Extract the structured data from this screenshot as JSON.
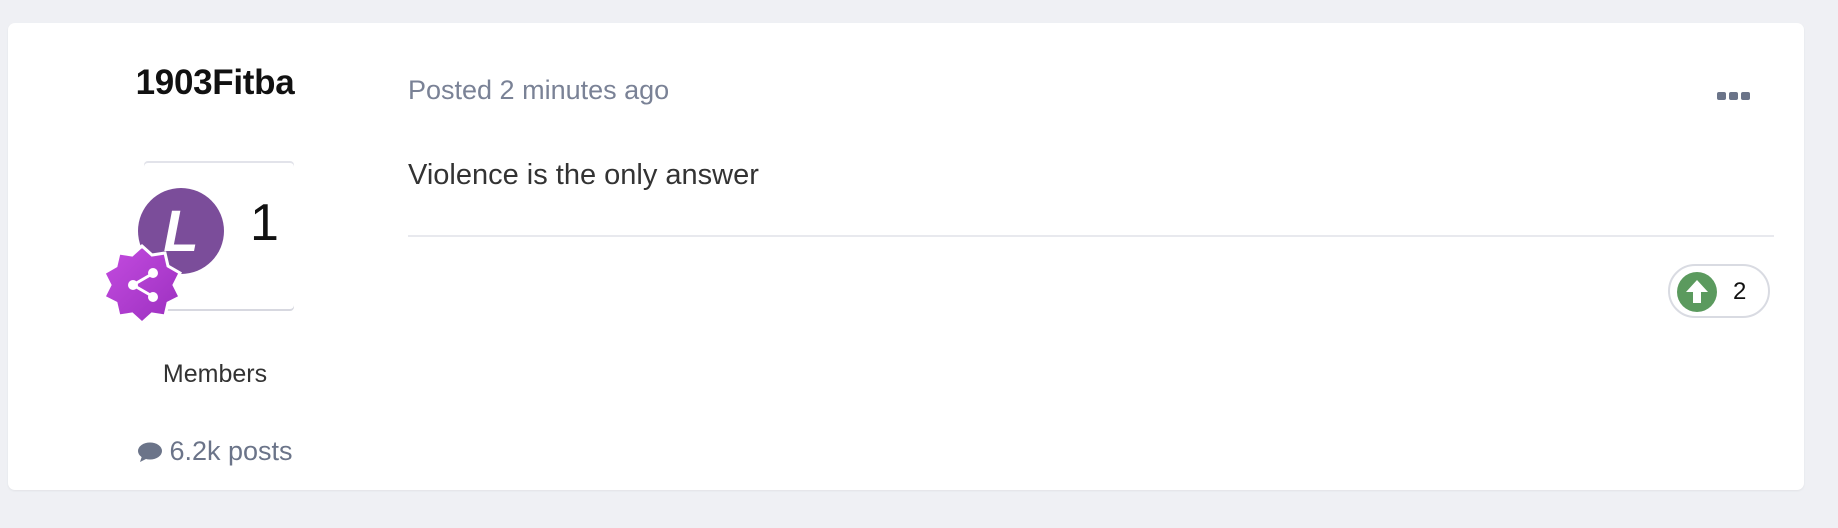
{
  "post": {
    "author": {
      "name": "1903Fitba",
      "avatar_letter": "L",
      "avatar_count": "1",
      "group": "Members",
      "post_count": "6.2k posts"
    },
    "meta": {
      "posted": "Posted 2 minutes ago"
    },
    "content": "Violence is the only answer",
    "reaction": {
      "icon": "upvote-icon",
      "count": "2"
    }
  },
  "colors": {
    "page_background": "#eff0f4",
    "card_background": "#ffffff",
    "avatar": "#7b4d9a",
    "badge": "#b03ecf",
    "upvote": "#5b9a5e",
    "muted_text": "#7a8296"
  }
}
